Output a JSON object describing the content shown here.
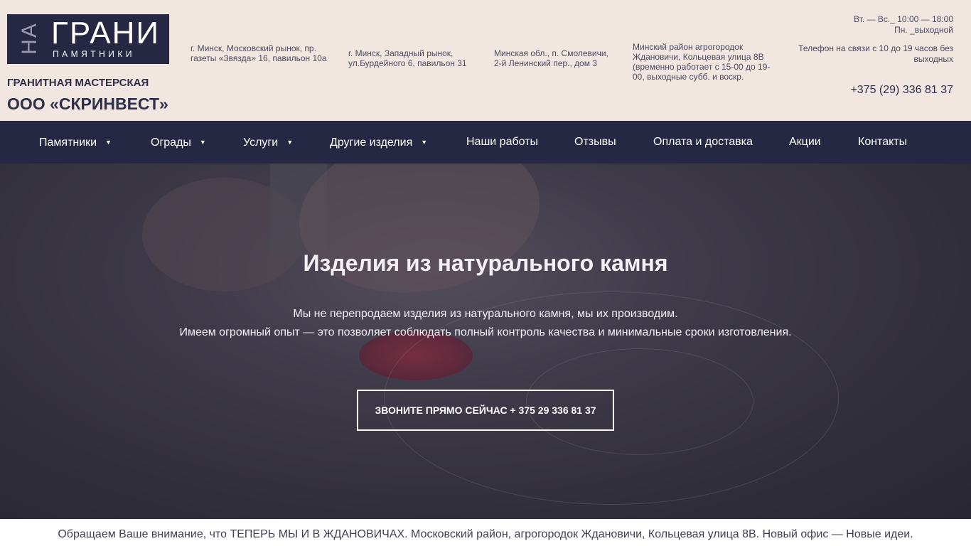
{
  "logo": {
    "na": "НА",
    "grani": "ГРАНИ",
    "pamyatniki": "ПАМЯТНИКИ"
  },
  "header": {
    "tagline": "ГРАНИТНАЯ МАСТЕРСКАЯ",
    "company": "ООО «СКРИНВЕСТ»",
    "addresses": [
      "г. Минск, Московский рынок, пр. газеты «Звязда» 16, павильон 10а",
      "г. Минск, Западный рынок, ул.Бурдейного 6, павильон 31",
      "Минская обл., п. Смолевичи, 2-й Ленинский пер., дом 3",
      "Минский район агрогородок Ждановичи, Кольцевая улица 8В (временно работает с 15-00 до 19-00, выходные субб. и воскр."
    ],
    "hours_line1": "Вт. — Вс._ 10:00 — 18:00",
    "hours_line2": "Пн. _выходной",
    "phone_note": "Телефон на связи с 10 до 19 часов без выходных",
    "phone": "+375 (29) 336 81 37"
  },
  "nav": {
    "items": [
      {
        "label": "Памятники",
        "has_dropdown": true
      },
      {
        "label": "Ограды",
        "has_dropdown": true
      },
      {
        "label": "Услуги",
        "has_dropdown": true
      },
      {
        "label": "Другие изделия",
        "has_dropdown": true
      },
      {
        "label": "Наши работы",
        "has_dropdown": false
      },
      {
        "label": "Отзывы",
        "has_dropdown": false
      },
      {
        "label": "Оплата и доставка",
        "has_dropdown": false
      },
      {
        "label": "Акции",
        "has_dropdown": false
      },
      {
        "label": "Контакты",
        "has_dropdown": false
      }
    ],
    "caret": "▼"
  },
  "hero": {
    "title": "Изделия из натурального камня",
    "line1": "Мы не перепродаем изделия из натурального камня, мы их производим.",
    "line2": "Имеем огромный опыт — это позволяет соблюдать полный контроль качества и минимальные сроки изготовления.",
    "cta": "ЗВОНИТЕ ПРЯМО СЕЙЧАС + 375 29 336 81 37"
  },
  "notice": "Обращаем Ваше внимание, что ТЕПЕРЬ МЫ И В ЖДАНОВИЧАХ.  Московский район, агрогородок Ждановичи, Кольцевая улица 8В. Новый офис — Новые идеи.",
  "colors": {
    "header_bg": "#f2e6e1",
    "nav_bg": "#262742",
    "text_dark": "#2d2e48"
  }
}
